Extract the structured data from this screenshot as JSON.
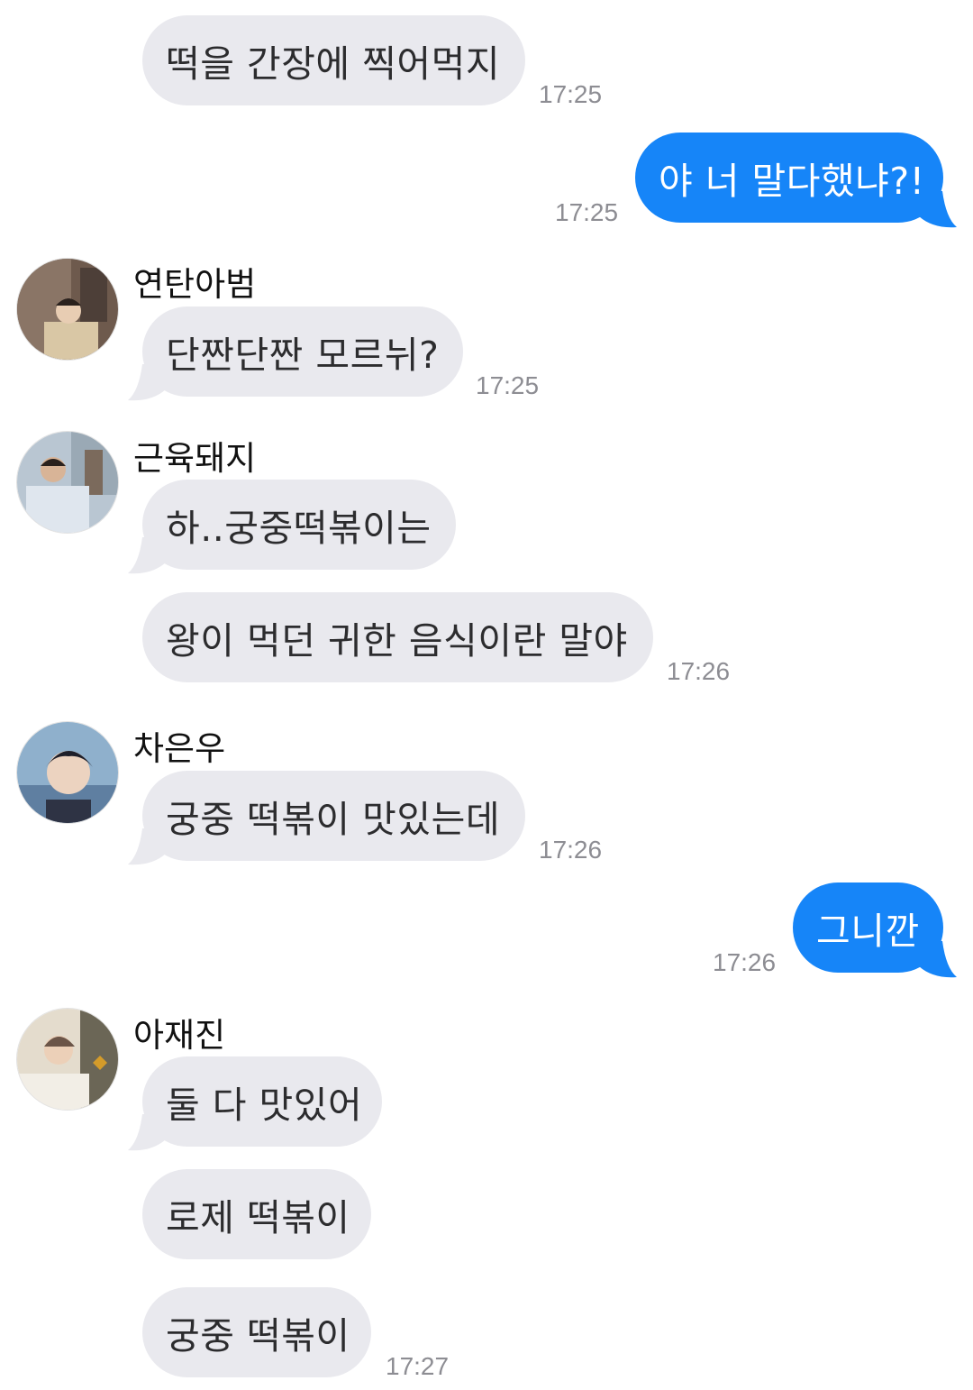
{
  "colors": {
    "incoming_bubble": "#e9e9ee",
    "outgoing_bubble": "#1685f8",
    "timestamp": "#8d8d93"
  },
  "messages": [
    {
      "type": "incoming",
      "text": "떡을 간장에 찍어먹지",
      "time": "17:25"
    },
    {
      "type": "outgoing",
      "text": "야 너 말다했냐?!",
      "time": "17:25"
    },
    {
      "type": "incoming",
      "sender": "연탄아범",
      "avatar": "avatar-photo-yeontan",
      "text": "단짠단짠 모르뉘?",
      "time": "17:25"
    },
    {
      "type": "incoming",
      "sender": "근육돼지",
      "avatar": "avatar-photo-geunyuk",
      "text": "하..궁중떡볶이는"
    },
    {
      "type": "incoming",
      "text": "왕이 먹던 귀한 음식이란 말야",
      "time": "17:26"
    },
    {
      "type": "incoming",
      "sender": "차은우",
      "avatar": "avatar-photo-cha",
      "text": "궁중 떡볶이 맛있는데",
      "time": "17:26"
    },
    {
      "type": "outgoing",
      "text": "그니깐",
      "time": "17:26"
    },
    {
      "type": "incoming",
      "sender": "아재진",
      "avatar": "avatar-photo-ajae",
      "text": "둘 다 맛있어"
    },
    {
      "type": "incoming",
      "text": "로제 떡볶이"
    },
    {
      "type": "incoming",
      "text": "궁중 떡볶이",
      "time": "17:27"
    }
  ]
}
